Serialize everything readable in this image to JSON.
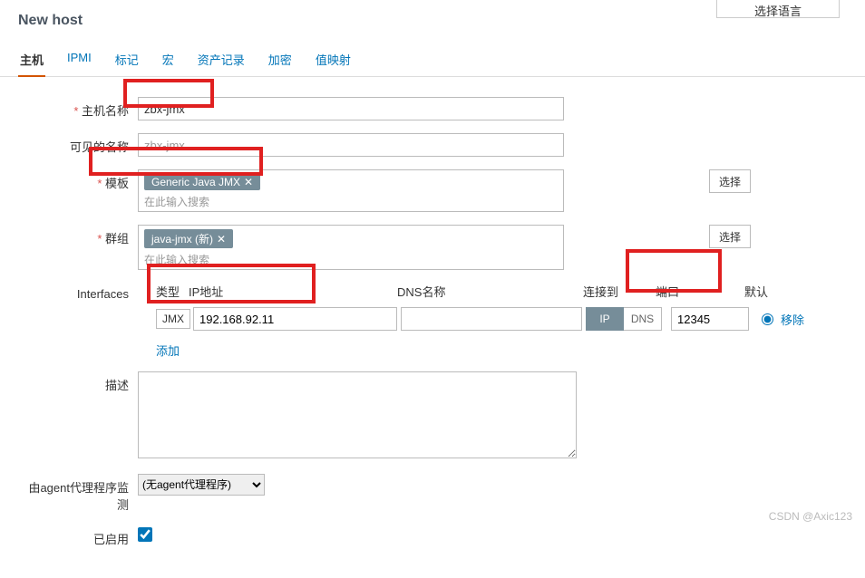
{
  "langBox": "选择语言",
  "pageTitle": "New host",
  "tabs": [
    "主机",
    "IPMI",
    "标记",
    "宏",
    "资产记录",
    "加密",
    "值映射"
  ],
  "labels": {
    "hostName": "主机名称",
    "visibleName": "可见的名称",
    "templates": "模板",
    "groups": "群组",
    "interfaces": "Interfaces",
    "description": "描述",
    "proxy": "由agent代理程序监测",
    "enabled": "已启用"
  },
  "values": {
    "hostName": "zbx-jmx",
    "visibleNamePlaceholder": "zbx-jmx",
    "templateTag": "Generic Java JMX",
    "templateSub": "在此输入搜索",
    "groupTag": "java-jmx (新)",
    "groupSub": "在此输入搜索",
    "proxyOption": "(无agent代理程序)"
  },
  "buttons": {
    "select": "选择",
    "add": "添加",
    "remove": "移除"
  },
  "iface": {
    "headers": {
      "type": "类型",
      "ip": "IP地址",
      "dns": "DNS名称",
      "conn": "连接到",
      "port": "端口",
      "def": "默认"
    },
    "type": "JMX",
    "ip": "192.168.92.11",
    "dns": "",
    "connIp": "IP",
    "connDns": "DNS",
    "port": "12345"
  },
  "watermark": "CSDN @Axic123"
}
